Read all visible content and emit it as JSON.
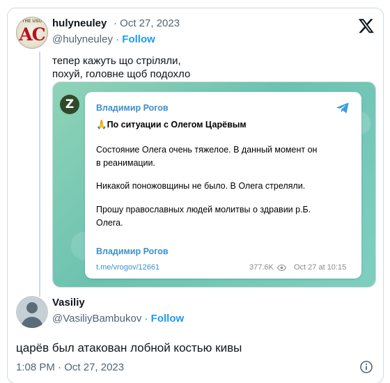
{
  "tweet1": {
    "avatar_seal": "THE USO",
    "avatar_letters": "AC",
    "display_name": "hulyneuley",
    "date": "Oct 27, 2023",
    "handle": "@hulyneuley",
    "follow_label": "Follow",
    "text_line1": "тепер кажуть що стріляли,",
    "text_line2": "похуй, головне щоб подохло"
  },
  "telegram": {
    "avatar_letter": "Z",
    "channel": "Владимир Рогов",
    "headline": "🙏По ситуации с Олегом Царёвым",
    "para1_line1": "Состояние Олега очень тяжелое. В данный момент он",
    "para1_line2": "в реанимации.",
    "para2": "Никакой поножовщины не было. В Олега стреляли.",
    "para3_line1": "Прошу православных людей молитвы о здравии р.Б.",
    "para3_line2": "Олега.",
    "link_name": "Владимир Рогов",
    "link": "t.me/vrogov/12661",
    "views": "377.6K",
    "post_date": "Oct 27 at 10:15"
  },
  "tweet2": {
    "display_name": "Vasiliy",
    "handle": "@VasiliyBambukov",
    "follow_label": "Follow",
    "text": "царёв был атакован лобной костью кивы",
    "time": "1:08 PM",
    "date": "Oct 27, 2023"
  },
  "colors": {
    "accent": "#1d9bf0",
    "telegram": "#3a8fd0",
    "muted": "#536471"
  }
}
